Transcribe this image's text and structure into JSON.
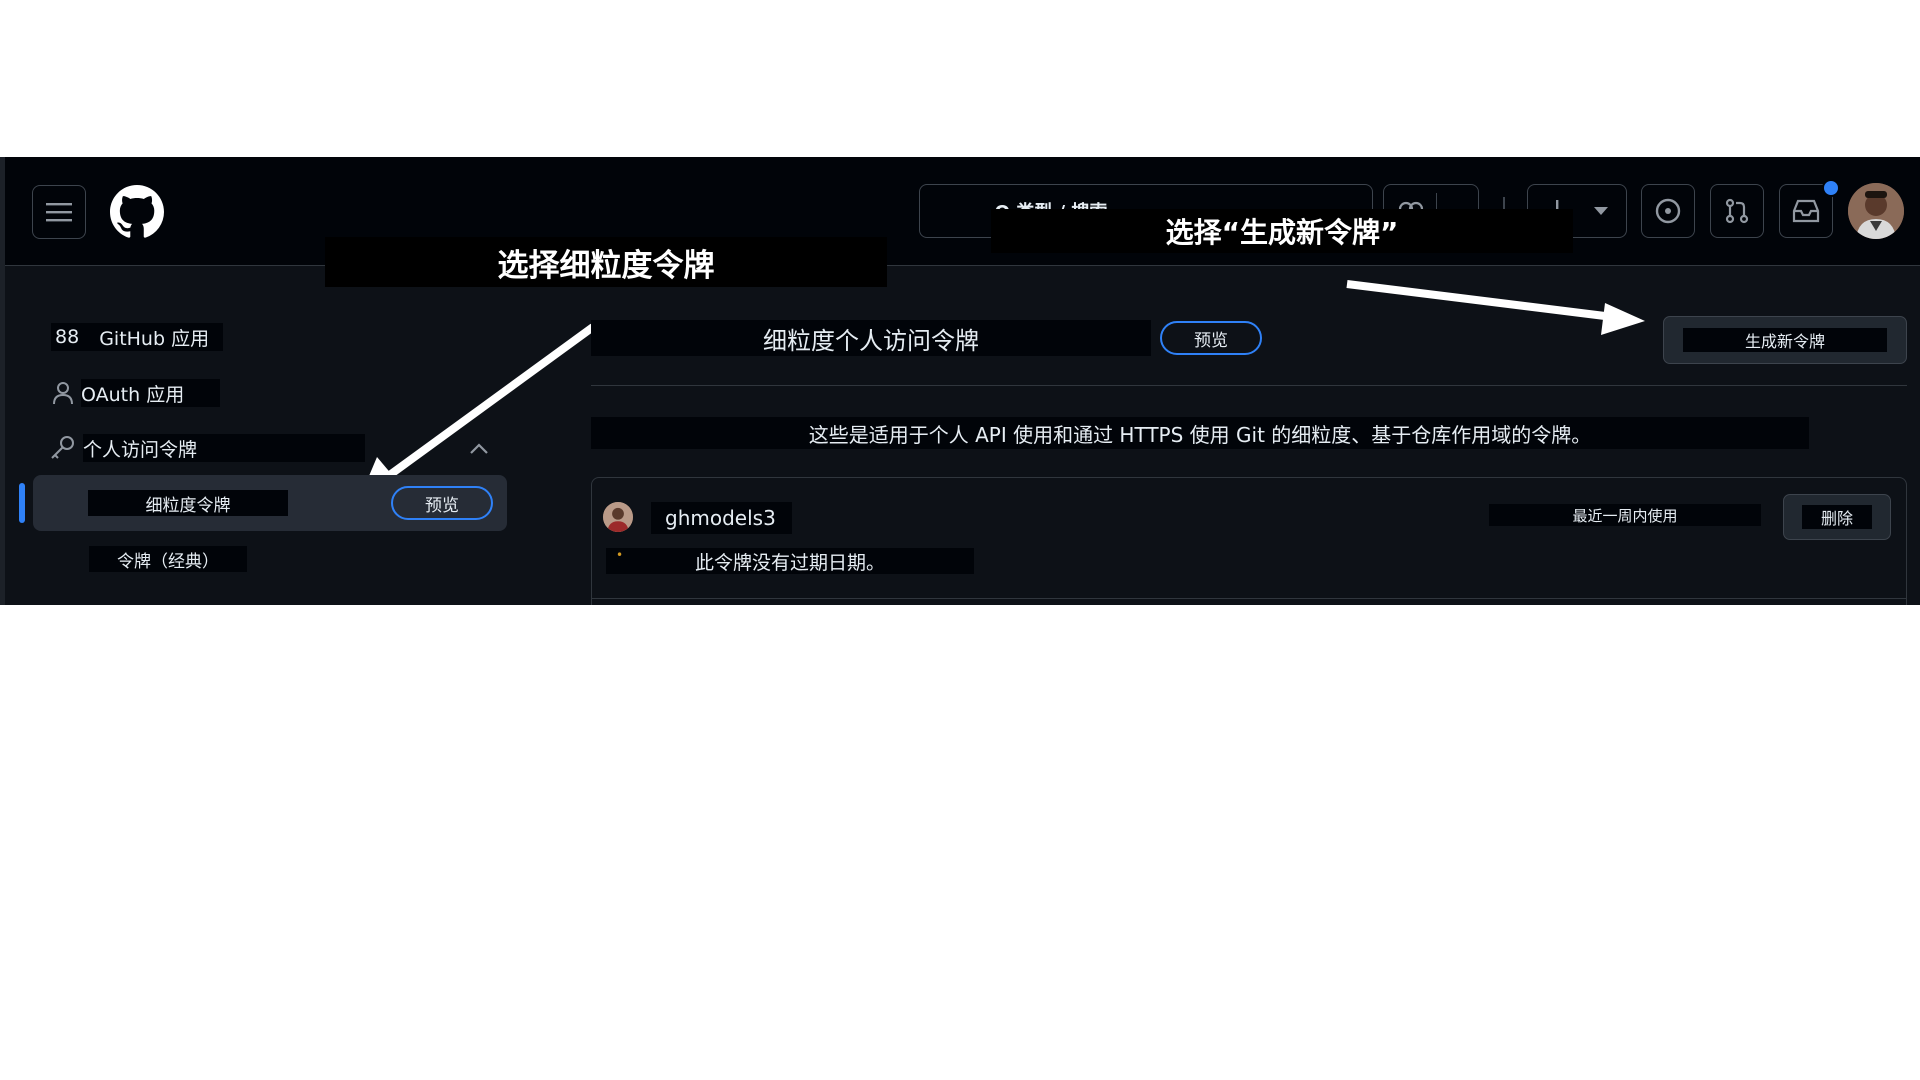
{
  "header": {
    "search_text": "Q 类型 / 搜索"
  },
  "annotations": {
    "select_fine_grained": "选择细粒度令牌",
    "select_generate": "选择“生成新令牌”"
  },
  "sidebar": {
    "github_apps_icon": "88",
    "github_apps_label": "GitHub 应用",
    "oauth_apps_label": "OAuth 应用",
    "pat_label": "个人访问令牌",
    "fine_grained_label": "细粒度令牌",
    "fine_grained_badge": "预览",
    "classic_label": "令牌（经典）"
  },
  "main": {
    "title": "细粒度个人访问令牌",
    "title_badge": "预览",
    "generate_button": "生成新令牌",
    "description": "这些是适用于个人 API 使用和通过 HTTPS 使用 Git 的细粒度、基于仓库作用域的令牌。",
    "token": {
      "name": "ghmodels3",
      "last_used": "最近一周内使用",
      "delete_button": "删除",
      "expiry": "此令牌没有过期日期。"
    }
  },
  "colors": {
    "background": "#0d1117",
    "header": "#010409",
    "accent": "#2f81f7",
    "text": "#e6edf3"
  }
}
